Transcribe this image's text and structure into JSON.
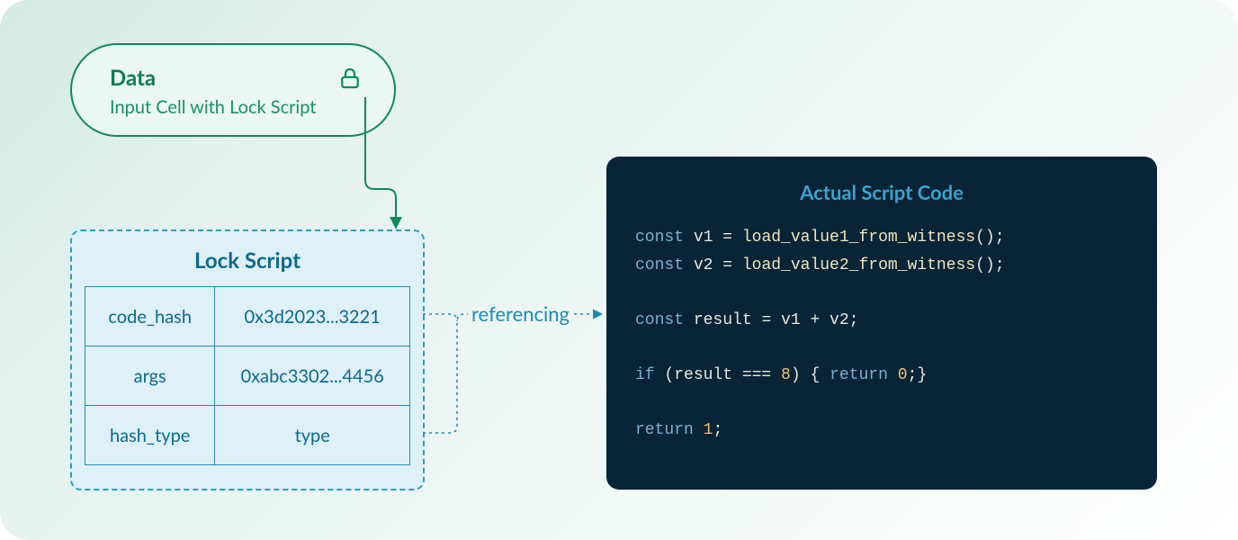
{
  "data_cell": {
    "title": "Data",
    "subtitle": "Input Cell with Lock Script",
    "icon": "lock-icon"
  },
  "lock_script": {
    "title": "Lock Script",
    "rows": {
      "r0k": "code_hash",
      "r0v": "0x3d2023...3221",
      "r1k": "args",
      "r1v": "0xabc3302...4456",
      "r2k": "hash_type",
      "r2v": "type"
    }
  },
  "referencing_label": "referencing",
  "code_panel": {
    "title": "Actual Script Code",
    "line1_kw": "const",
    "line1_var": " v1 ",
    "line1_eq": "= ",
    "line1_fn": "load_value1_from_witness",
    "line1_paren": "();",
    "line2_kw": "const",
    "line2_var": " v2 ",
    "line2_eq": "= ",
    "line2_fn": "load_value2_from_witness",
    "line2_paren": "();",
    "line3_kw": "const",
    "line3_var": " result ",
    "line3_eq": "= ",
    "line3_expr": "v1 + v2;",
    "line4_kw1": "if",
    "line4_cond": " (result === ",
    "line4_num": "8",
    "line4_mid": ") { ",
    "line4_kw2": "return",
    "line4_ret": " ",
    "line4_num2": "0",
    "line4_end": ";}",
    "line5_kw": "return",
    "line5_sp": " ",
    "line5_num": "1",
    "line5_end": ";"
  },
  "colors": {
    "accent_green": "#0d8a5f",
    "accent_blue": "#1f8bb3",
    "code_bg": "#082436"
  }
}
